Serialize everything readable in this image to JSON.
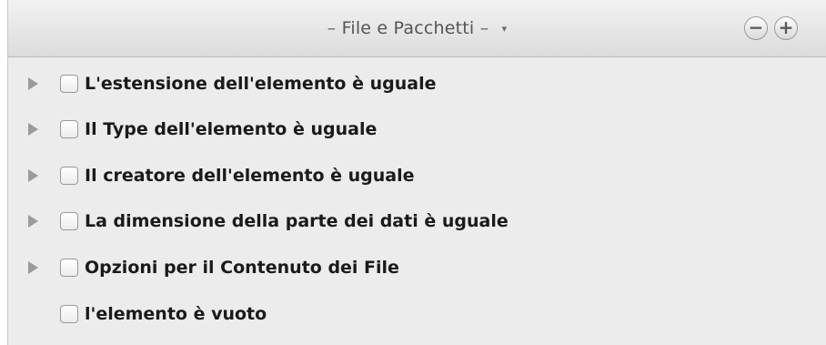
{
  "header": {
    "dash_left": "–",
    "title": "File e Pacchetti",
    "dash_right": "–",
    "caret": "▾",
    "remove_glyph": "−",
    "add_glyph": "+"
  },
  "items": [
    {
      "label": "L'estensione dell'elemento è uguale",
      "expandable": true,
      "checked": false
    },
    {
      "label": "Il Type dell'elemento è uguale",
      "expandable": true,
      "checked": false
    },
    {
      "label": "Il creatore dell'elemento è uguale",
      "expandable": true,
      "checked": false
    },
    {
      "label": "La dimensione della parte dei dati è uguale",
      "expandable": true,
      "checked": false
    },
    {
      "label": "Opzioni per il Contenuto dei File",
      "expandable": true,
      "checked": false
    },
    {
      "label": "l'elemento è vuoto",
      "expandable": false,
      "checked": false
    }
  ]
}
